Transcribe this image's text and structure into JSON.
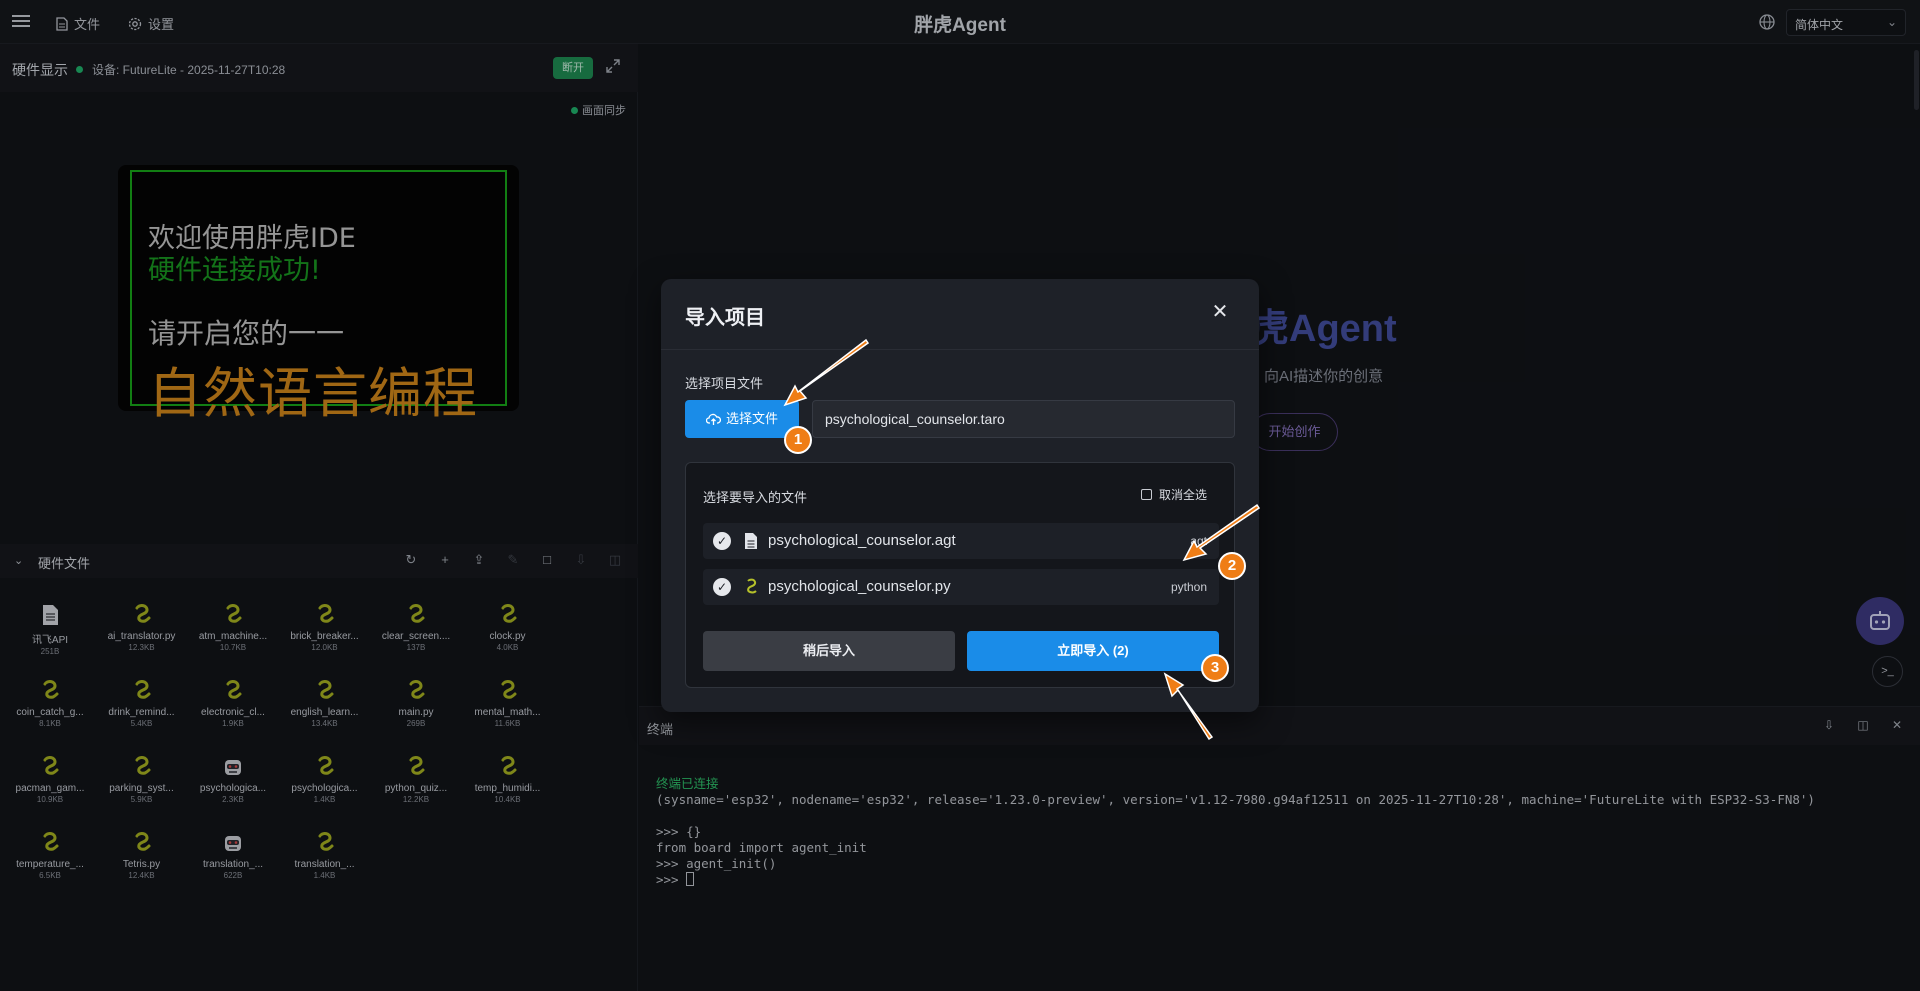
{
  "topbar": {
    "file_label": "文件",
    "settings_label": "设置",
    "title": "胖虎Agent",
    "language": "简体中文"
  },
  "hardware": {
    "title": "硬件显示",
    "device": "设备: FutureLite - 2025-11-27T10:28",
    "disconnect_label": "断开",
    "sync_label": "画面同步",
    "screen_lines": [
      "欢迎使用胖虎IDE",
      "硬件连接成功!",
      "请开启您的一一",
      "自然语言编程"
    ]
  },
  "files": {
    "title": "硬件文件",
    "items": [
      {
        "name": "讯飞API",
        "size": "251B",
        "icon": "document-icon"
      },
      {
        "name": "ai_translator.py",
        "size": "12.3KB",
        "icon": "python-icon"
      },
      {
        "name": "atm_machine...",
        "size": "10.7KB",
        "icon": "python-icon"
      },
      {
        "name": "brick_breaker...",
        "size": "12.0KB",
        "icon": "python-icon"
      },
      {
        "name": "clear_screen....",
        "size": "137B",
        "icon": "python-icon"
      },
      {
        "name": "clock.py",
        "size": "4.0KB",
        "icon": "python-icon"
      },
      {
        "name": "coin_catch_g...",
        "size": "8.1KB",
        "icon": "python-icon"
      },
      {
        "name": "drink_remind...",
        "size": "5.4KB",
        "icon": "python-icon"
      },
      {
        "name": "electronic_cl...",
        "size": "1.9KB",
        "icon": "python-icon"
      },
      {
        "name": "english_learn...",
        "size": "13.4KB",
        "icon": "python-icon"
      },
      {
        "name": "main.py",
        "size": "269B",
        "icon": "python-icon"
      },
      {
        "name": "mental_math...",
        "size": "11.6KB",
        "icon": "python-icon"
      },
      {
        "name": "pacman_gam...",
        "size": "10.9KB",
        "icon": "python-icon"
      },
      {
        "name": "parking_syst...",
        "size": "5.9KB",
        "icon": "python-icon"
      },
      {
        "name": "psychologica...",
        "size": "2.3KB",
        "icon": "robot-icon"
      },
      {
        "name": "psychologica...",
        "size": "1.4KB",
        "icon": "python-icon"
      },
      {
        "name": "python_quiz...",
        "size": "12.2KB",
        "icon": "python-icon"
      },
      {
        "name": "temp_humidi...",
        "size": "10.4KB",
        "icon": "python-icon"
      },
      {
        "name": "temperature_...",
        "size": "6.5KB",
        "icon": "python-icon"
      },
      {
        "name": "Tetris.py",
        "size": "12.4KB",
        "icon": "python-icon"
      },
      {
        "name": "translation_...",
        "size": "622B",
        "icon": "robot-icon"
      },
      {
        "name": "translation_...",
        "size": "1.4KB",
        "icon": "python-icon"
      }
    ]
  },
  "agent": {
    "brand": "虎Agent",
    "tagline": "向AI描述你的创意",
    "start_label": "开始创作"
  },
  "terminal": {
    "title": "终端",
    "connected": "终端已连接",
    "lines": [
      "(sysname='esp32', nodename='esp32', release='1.23.0-preview', version='v1.12-7980.g94af12511 on 2025-11-27T10:28', machine='FutureLite with ESP32-S3-FN8')",
      "",
      ">>> {}",
      "from board import agent_init",
      ">>> agent_init()",
      ">>> "
    ]
  },
  "modal": {
    "title": "导入项目",
    "file_section_label": "选择项目文件",
    "pick_button": "选择文件",
    "file_path": "psychological_counselor.taro",
    "list_label": "选择要导入的文件",
    "deselect_all": "取消全选",
    "files": [
      {
        "name": "psychological_counselor.agt",
        "type": "agt"
      },
      {
        "name": "psychological_counselor.py",
        "type": "python"
      }
    ],
    "later_button": "稍后导入",
    "now_button": "立即导入 (2)"
  },
  "annotations": {
    "badges": [
      "1",
      "2",
      "3"
    ],
    "color": "#ef7d16"
  },
  "colors": {
    "primary": "#1a8ce8",
    "connected": "#21b46e",
    "accent_purple": "#4451a3"
  }
}
